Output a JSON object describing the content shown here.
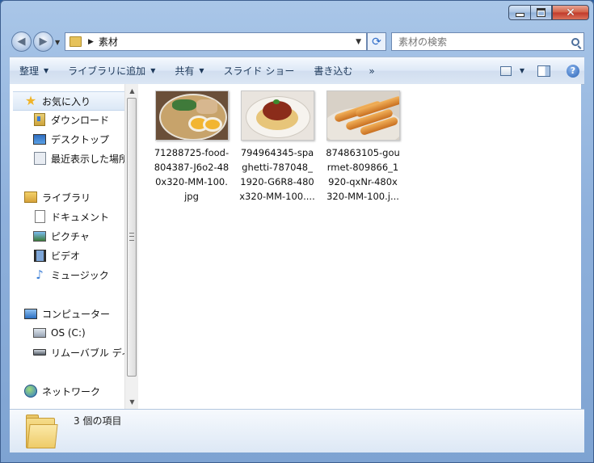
{
  "window": {
    "caption_close": "✕"
  },
  "address_bar": {
    "current_folder": "素材"
  },
  "search": {
    "placeholder": "素材の検索"
  },
  "toolbar": {
    "organize": "整理",
    "add_to_library": "ライブラリに追加",
    "share": "共有",
    "slideshow": "スライド ショー",
    "burn": "書き込む",
    "more": "»"
  },
  "nav_pane": {
    "favorites": "お気に入り",
    "downloads": "ダウンロード",
    "desktop": "デスクトップ",
    "recent": "最近表示した場所",
    "libraries": "ライブラリ",
    "documents": "ドキュメント",
    "pictures": "ピクチャ",
    "videos": "ビデオ",
    "music": "ミュージック",
    "computer": "コンピューター",
    "os_drive": "OS (C:)",
    "removable": "リムーバブル ディスク",
    "network": "ネットワーク"
  },
  "files": [
    {
      "line1": "71288725-food-",
      "line2": "804387-J6o2-48",
      "line3": "0x320-MM-100.",
      "line4": "jpg"
    },
    {
      "line1": "794964345-spa",
      "line2": "ghetti-787048_",
      "line3": "1920-G6R8-480",
      "line4": "x320-MM-100...."
    },
    {
      "line1": "874863105-gou",
      "line2": "rmet-809866_1",
      "line3": "920-qxNr-480x",
      "line4": "320-MM-100.j..."
    }
  ],
  "status": {
    "item_count": "3 個の項目"
  },
  "colors": {
    "accent": "#1e395b",
    "close_button": "#c1392a"
  }
}
